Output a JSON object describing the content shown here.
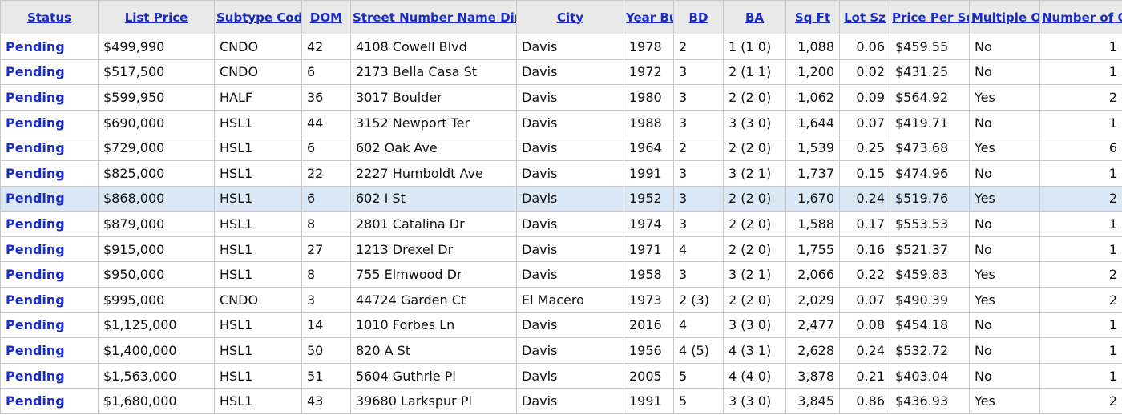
{
  "table": {
    "headers": [
      {
        "key": "status",
        "label": "Status"
      },
      {
        "key": "list_price",
        "label": "List Price"
      },
      {
        "key": "subtype",
        "label": "Subtype Code"
      },
      {
        "key": "dom",
        "label": "DOM"
      },
      {
        "key": "address",
        "label": "Street Number Name Direction"
      },
      {
        "key": "city",
        "label": "City"
      },
      {
        "key": "year_built",
        "label": "Year Built"
      },
      {
        "key": "bd",
        "label": "BD"
      },
      {
        "key": "ba",
        "label": "BA"
      },
      {
        "key": "sqft",
        "label": "Sq Ft"
      },
      {
        "key": "lot",
        "label": "Lot Sz"
      },
      {
        "key": "ppsf",
        "label": "Price Per Sq Ft"
      },
      {
        "key": "multiple",
        "label": "Multiple Offers"
      },
      {
        "key": "offers",
        "label": "Number of Offers"
      }
    ],
    "rows": [
      {
        "status": "Pending",
        "list_price": "$499,990",
        "subtype": "CNDO",
        "dom": "42",
        "address": "4108 Cowell Blvd",
        "city": "Davis",
        "year_built": "1978",
        "bd": "2",
        "ba": "1 (1 0)",
        "sqft": "1,088",
        "lot": "0.06",
        "ppsf": "$459.55",
        "multiple": "No",
        "offers": "1"
      },
      {
        "status": "Pending",
        "list_price": "$517,500",
        "subtype": "CNDO",
        "dom": "6",
        "address": "2173 Bella Casa St",
        "city": "Davis",
        "year_built": "1972",
        "bd": "3",
        "ba": "2 (1 1)",
        "sqft": "1,200",
        "lot": "0.02",
        "ppsf": "$431.25",
        "multiple": "No",
        "offers": "1"
      },
      {
        "status": "Pending",
        "list_price": "$599,950",
        "subtype": "HALF",
        "dom": "36",
        "address": "3017 Boulder",
        "city": "Davis",
        "year_built": "1980",
        "bd": "3",
        "ba": "2 (2 0)",
        "sqft": "1,062",
        "lot": "0.09",
        "ppsf": "$564.92",
        "multiple": "Yes",
        "offers": "2"
      },
      {
        "status": "Pending",
        "list_price": "$690,000",
        "subtype": "HSL1",
        "dom": "44",
        "address": "3152 Newport Ter",
        "city": "Davis",
        "year_built": "1988",
        "bd": "3",
        "ba": "3 (3 0)",
        "sqft": "1,644",
        "lot": "0.07",
        "ppsf": "$419.71",
        "multiple": "No",
        "offers": "1"
      },
      {
        "status": "Pending",
        "list_price": "$729,000",
        "subtype": "HSL1",
        "dom": "6",
        "address": "602 Oak Ave",
        "city": "Davis",
        "year_built": "1964",
        "bd": "2",
        "ba": "2 (2 0)",
        "sqft": "1,539",
        "lot": "0.25",
        "ppsf": "$473.68",
        "multiple": "Yes",
        "offers": "6"
      },
      {
        "status": "Pending",
        "list_price": "$825,000",
        "subtype": "HSL1",
        "dom": "22",
        "address": "2227 Humboldt Ave",
        "city": "Davis",
        "year_built": "1991",
        "bd": "3",
        "ba": "3 (2 1)",
        "sqft": "1,737",
        "lot": "0.15",
        "ppsf": "$474.96",
        "multiple": "No",
        "offers": "1"
      },
      {
        "status": "Pending",
        "list_price": "$868,000",
        "subtype": "HSL1",
        "dom": "6",
        "address": "602 I St",
        "city": "Davis",
        "year_built": "1952",
        "bd": "3",
        "ba": "2 (2 0)",
        "sqft": "1,670",
        "lot": "0.24",
        "ppsf": "$519.76",
        "multiple": "Yes",
        "offers": "2"
      },
      {
        "status": "Pending",
        "list_price": "$879,000",
        "subtype": "HSL1",
        "dom": "8",
        "address": "2801 Catalina Dr",
        "city": "Davis",
        "year_built": "1974",
        "bd": "3",
        "ba": "2 (2 0)",
        "sqft": "1,588",
        "lot": "0.17",
        "ppsf": "$553.53",
        "multiple": "No",
        "offers": "1"
      },
      {
        "status": "Pending",
        "list_price": "$915,000",
        "subtype": "HSL1",
        "dom": "27",
        "address": "1213 Drexel Dr",
        "city": "Davis",
        "year_built": "1971",
        "bd": "4",
        "ba": "2 (2 0)",
        "sqft": "1,755",
        "lot": "0.16",
        "ppsf": "$521.37",
        "multiple": "No",
        "offers": "1"
      },
      {
        "status": "Pending",
        "list_price": "$950,000",
        "subtype": "HSL1",
        "dom": "8",
        "address": "755 Elmwood Dr",
        "city": "Davis",
        "year_built": "1958",
        "bd": "3",
        "ba": "3 (2 1)",
        "sqft": "2,066",
        "lot": "0.22",
        "ppsf": "$459.83",
        "multiple": "Yes",
        "offers": "2"
      },
      {
        "status": "Pending",
        "list_price": "$995,000",
        "subtype": "CNDO",
        "dom": "3",
        "address": "44724 Garden Ct",
        "city": "El Macero",
        "year_built": "1973",
        "bd": "2 (3)",
        "ba": "2 (2 0)",
        "sqft": "2,029",
        "lot": "0.07",
        "ppsf": "$490.39",
        "multiple": "Yes",
        "offers": "2"
      },
      {
        "status": "Pending",
        "list_price": "$1,125,000",
        "subtype": "HSL1",
        "dom": "14",
        "address": "1010 Forbes Ln",
        "city": "Davis",
        "year_built": "2016",
        "bd": "4",
        "ba": "3 (3 0)",
        "sqft": "2,477",
        "lot": "0.08",
        "ppsf": "$454.18",
        "multiple": "No",
        "offers": "1"
      },
      {
        "status": "Pending",
        "list_price": "$1,400,000",
        "subtype": "HSL1",
        "dom": "50",
        "address": "820 A St",
        "city": "Davis",
        "year_built": "1956",
        "bd": "4 (5)",
        "ba": "4 (3 1)",
        "sqft": "2,628",
        "lot": "0.24",
        "ppsf": "$532.72",
        "multiple": "No",
        "offers": "1"
      },
      {
        "status": "Pending",
        "list_price": "$1,563,000",
        "subtype": "HSL1",
        "dom": "51",
        "address": "5604 Guthrie Pl",
        "city": "Davis",
        "year_built": "2005",
        "bd": "5",
        "ba": "4 (4 0)",
        "sqft": "3,878",
        "lot": "0.21",
        "ppsf": "$403.04",
        "multiple": "No",
        "offers": "1"
      },
      {
        "status": "Pending",
        "list_price": "$1,680,000",
        "subtype": "HSL1",
        "dom": "43",
        "address": "39680 Larkspur Pl",
        "city": "Davis",
        "year_built": "1991",
        "bd": "5",
        "ba": "3 (3 0)",
        "sqft": "3,845",
        "lot": "0.86",
        "ppsf": "$436.93",
        "multiple": "Yes",
        "offers": "2"
      }
    ]
  }
}
